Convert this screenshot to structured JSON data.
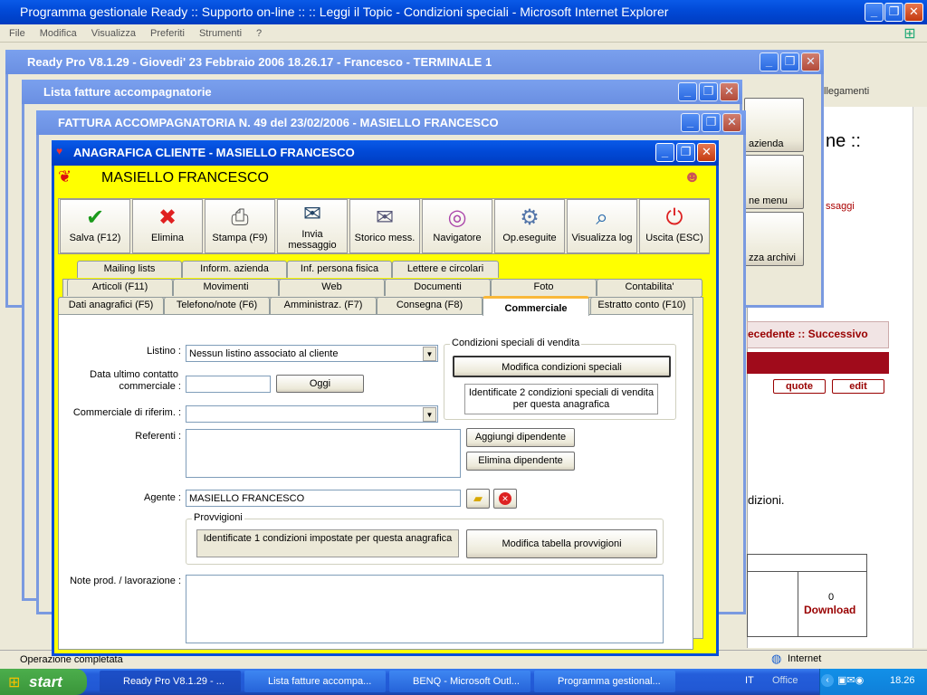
{
  "ie": {
    "title": "Programma gestionale Ready :: Supporto on-line :: :: Leggi il Topic - Condizioni speciali - Microsoft Internet Explorer",
    "menu": [
      "File",
      "Modifica",
      "Visualizza",
      "Preferiti",
      "Strumenti",
      "?"
    ],
    "status": "Operazione completata",
    "zone": "Internet",
    "right_text": {
      "t1": "ne ::",
      "t2": "ssaggi",
      "t3": "llegamenti",
      "t4": "ecedente :: Successivo",
      "quote": "quote",
      "edit": "edit",
      "dizioni": "dizioni.",
      "download": "Download",
      "download_count": "0"
    }
  },
  "ready": {
    "title": "Ready Pro V8.1.29 - Giovedi' 23 Febbraio 2006  18.26.17 - Francesco - TERMINALE 1",
    "side": [
      "azienda",
      "ne menu",
      "zza archivi"
    ]
  },
  "lista": {
    "title": "Lista fatture accompagnatorie"
  },
  "fattura": {
    "title": "FATTURA ACCOMPAGNATORIA N. 49  del 23/02/2006 - MASIELLO FRANCESCO"
  },
  "cliente": {
    "title": "ANAGRAFICA CLIENTE - MASIELLO FRANCESCO",
    "name": "MASIELLO FRANCESCO",
    "toolbar": [
      {
        "label": "Salva (F12)",
        "icon": "check-icon"
      },
      {
        "label": "Elimina",
        "icon": "delete-icon"
      },
      {
        "label": "Stampa (F9)",
        "icon": "printer-icon"
      },
      {
        "label": "Invia messaggio",
        "icon": "message-icon"
      },
      {
        "label": "Storico mess.",
        "icon": "mail-history-icon"
      },
      {
        "label": "Navigatore",
        "icon": "navigator-icon"
      },
      {
        "label": "Op.eseguite",
        "icon": "gears-icon"
      },
      {
        "label": "Visualizza log",
        "icon": "log-icon"
      },
      {
        "label": "Uscita (ESC)",
        "icon": "exit-icon"
      }
    ],
    "tabs_row1": [
      "Mailing lists",
      "Inform. azienda",
      "Inf. persona fisica",
      "Lettere e circolari"
    ],
    "tabs_row2": [
      "Articoli (F11)",
      "Movimenti",
      "Web",
      "Documenti",
      "Foto",
      "Contabilita'"
    ],
    "tabs_row3": [
      "Dati anagrafici (F5)",
      "Telefono/note (F6)",
      "Amministraz. (F7)",
      "Consegna (F8)",
      "Commerciale",
      "Estratto conto (F10)"
    ],
    "form": {
      "listino_label": "Listino :",
      "listino_value": "Nessun listino associato al cliente",
      "data_label1": "Data ultimo contatto",
      "data_label2": "commerciale :",
      "data_value": "",
      "oggi": "Oggi",
      "comm_label": "Commerciale di riferim. :",
      "comm_value": "",
      "referenti_label": "Referenti :",
      "aggiungi": "Aggiungi dipendente",
      "elimina_dip": "Elimina dipendente",
      "agente_label": "Agente :",
      "agente_value": "MASIELLO FRANCESCO",
      "note_label": "Note prod. / lavorazione :"
    },
    "cond": {
      "title": "Condizioni speciali di vendita",
      "button": "Modifica condizioni speciali",
      "info1": "Identificate 2 condizioni speciali di vendita",
      "info2": "per questa anagrafica"
    },
    "provv": {
      "title": "Provvigioni",
      "info": "Identificate 1 condizioni impostate per questa anagrafica",
      "button": "Modifica tabella provvigioni"
    }
  },
  "taskbar": {
    "start": "start",
    "items": [
      "Ready Pro V8.1.29 - ...",
      "Lista fatture accompa...",
      "BENQ - Microsoft Outl...",
      "Programma gestional..."
    ],
    "lang": "IT",
    "office": "Office",
    "clock": "18.26"
  }
}
